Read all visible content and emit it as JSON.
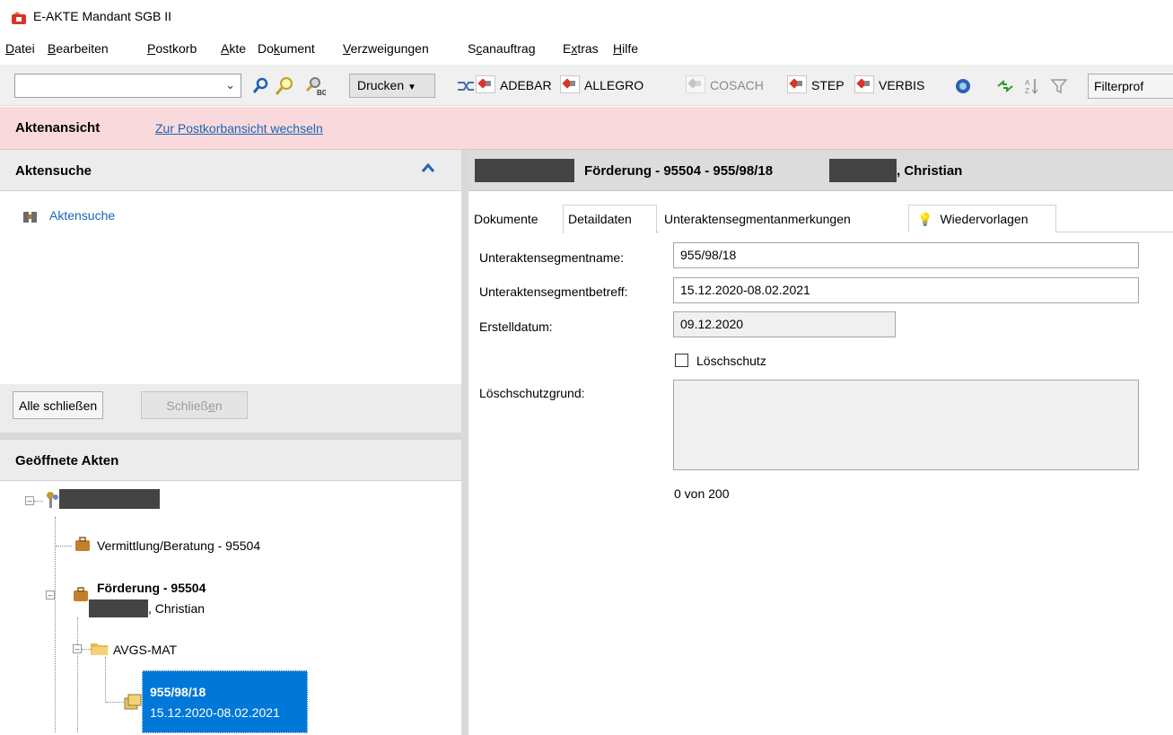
{
  "window": {
    "title": "E-AKTE Mandant SGB II"
  },
  "menu": [
    {
      "label": "Datei",
      "u": "D",
      "rest": "atei"
    },
    {
      "label": "Bearbeiten",
      "u": "B",
      "rest": "earbeiten"
    },
    {
      "label": "Postkorb",
      "u": "P",
      "rest": "ostkorb"
    },
    {
      "label": "Akte",
      "u": "A",
      "rest": "kte"
    },
    {
      "label": "Dokument",
      "pre": "Do",
      "u": "k",
      "rest": "ument"
    },
    {
      "label": "Verzweigungen",
      "u": "V",
      "rest": "erzweigungen"
    },
    {
      "label": "Scanauftrag",
      "pre": "S",
      "u": "c",
      "rest": "anauftrag"
    },
    {
      "label": "Extras",
      "pre": "E",
      "u": "x",
      "rest": "tras"
    },
    {
      "label": "Hilfe",
      "u": "H",
      "rest": "ilfe"
    }
  ],
  "toolbar": {
    "search_value": "",
    "print_label": "Drucken",
    "apps": [
      "ADEBAR",
      "ALLEGRO",
      "COSACH",
      "STEP",
      "VERBIS"
    ],
    "filter_label": "Filterprof"
  },
  "banner": {
    "view_label": "Aktenansicht",
    "switch_link": "Zur Postkorbansicht wechseln"
  },
  "left": {
    "search_header": "Aktensuche",
    "search_link": "Aktensuche",
    "close_all": "Alle schließen",
    "close_pre": "Schließ",
    "close_u": "e",
    "close_post": "n",
    "open_header": "Geöffnete Akten",
    "tree": {
      "node1": "Vermittlung/Beratung - 95504",
      "node2_title": "Förderung - 95504",
      "node2_sub": ", Christian",
      "node3": "AVGS-MAT",
      "node4_title": "955/98/18",
      "node4_sub": "15.12.2020-08.02.2021"
    }
  },
  "right": {
    "header": "Förderung - 95504 - 955/98/18",
    "header_suffix": ", Christian",
    "tabs": [
      "Dokumente",
      "Detaildaten",
      "Unteraktensegmentanmerkungen",
      "Wiedervorlagen"
    ],
    "active_tab": "Detaildaten",
    "fields": {
      "name_label": "Unteraktensegmentname:",
      "name_value": "955/98/18",
      "betreff_label": "Unteraktensegmentbetreff:",
      "betreff_value": "15.12.2020-08.02.2021",
      "date_label": "Erstelldatum:",
      "date_value": "09.12.2020",
      "loeschschutz_label": "Löschschutz",
      "loeschschutz_checked": false,
      "grund_label": "Löschschutzgrund:",
      "grund_value": "",
      "counter": "0 von 200"
    }
  }
}
